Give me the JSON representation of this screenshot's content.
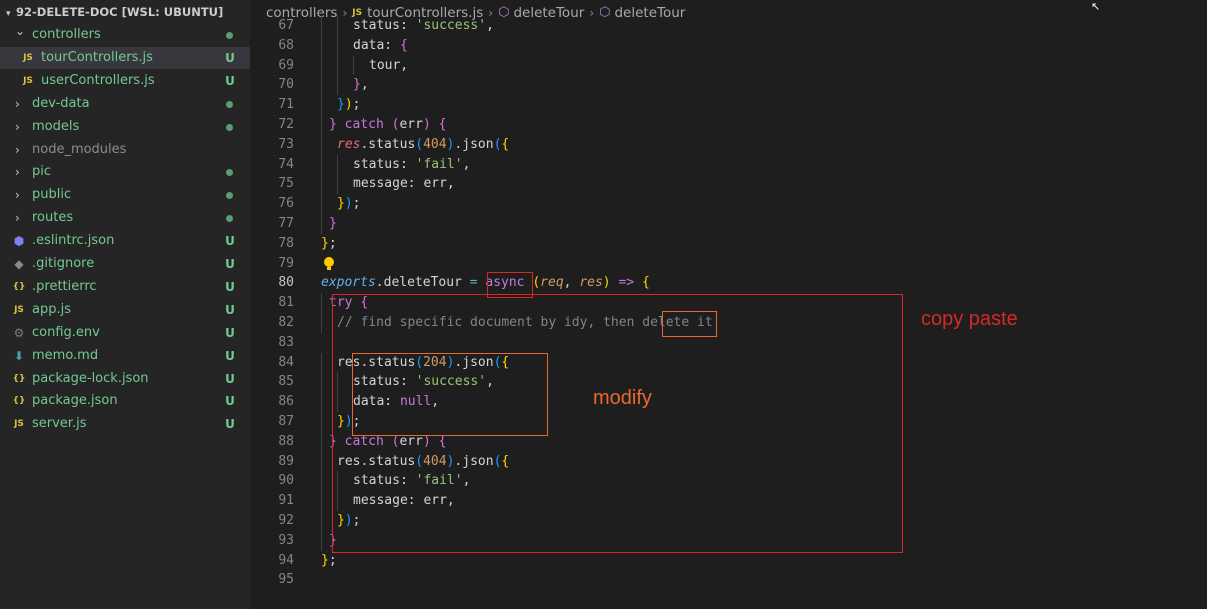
{
  "explorer": {
    "title": "92-DELETE-DOC [WSL: UBUNTU]",
    "items": [
      {
        "label": "controllers",
        "type": "folder-open",
        "depth": 0,
        "color": "#73c991",
        "badge": "dot"
      },
      {
        "label": "tourControllers.js",
        "type": "js",
        "depth": 1,
        "color": "#73c991",
        "badge": "U",
        "selected": true
      },
      {
        "label": "userControllers.js",
        "type": "js",
        "depth": 1,
        "color": "#73c991",
        "badge": "U"
      },
      {
        "label": "dev-data",
        "type": "folder",
        "depth": 0,
        "color": "#73c991",
        "badge": "dot"
      },
      {
        "label": "models",
        "type": "folder",
        "depth": 0,
        "color": "#73c991",
        "badge": "dot"
      },
      {
        "label": "node_modules",
        "type": "folder",
        "depth": 0,
        "color": "#8c8c8c",
        "badge": ""
      },
      {
        "label": "pic",
        "type": "folder",
        "depth": 0,
        "color": "#73c991",
        "badge": "dot"
      },
      {
        "label": "public",
        "type": "folder",
        "depth": 0,
        "color": "#73c991",
        "badge": "dot"
      },
      {
        "label": "routes",
        "type": "folder",
        "depth": 0,
        "color": "#73c991",
        "badge": "dot"
      },
      {
        "label": ".eslintrc.json",
        "type": "eslint",
        "depth": 0,
        "color": "#73c991",
        "badge": "U"
      },
      {
        "label": ".gitignore",
        "type": "git",
        "depth": 0,
        "color": "#73c991",
        "badge": "U"
      },
      {
        "label": ".prettierrc",
        "type": "json",
        "depth": 0,
        "color": "#73c991",
        "badge": "U"
      },
      {
        "label": "app.js",
        "type": "js",
        "depth": 0,
        "color": "#73c991",
        "badge": "U"
      },
      {
        "label": "config.env",
        "type": "gear",
        "depth": 0,
        "color": "#73c991",
        "badge": "U"
      },
      {
        "label": "memo.md",
        "type": "md",
        "depth": 0,
        "color": "#73c991",
        "badge": "U"
      },
      {
        "label": "package-lock.json",
        "type": "json",
        "depth": 0,
        "color": "#73c991",
        "badge": "U"
      },
      {
        "label": "package.json",
        "type": "json",
        "depth": 0,
        "color": "#73c991",
        "badge": "U"
      },
      {
        "label": "server.js",
        "type": "js",
        "depth": 0,
        "color": "#73c991",
        "badge": "U"
      }
    ]
  },
  "breadcrumb": {
    "folder": "controllers",
    "file_icon": "JS",
    "file": "tourControllers.js",
    "symbol1": "deleteTour",
    "symbol2": "deleteTour"
  },
  "code": {
    "active_line": 80,
    "lines": [
      {
        "n": "67",
        "indent": 2,
        "tokens": [
          [
            "",
            "status: "
          ],
          [
            "str",
            "'success'"
          ],
          [
            "",
            ","
          ]
        ]
      },
      {
        "n": "68",
        "indent": 2,
        "tokens": [
          [
            "",
            "data: "
          ],
          [
            "b2",
            "{"
          ]
        ]
      },
      {
        "n": "69",
        "indent": 3,
        "tokens": [
          [
            "",
            "tour,"
          ]
        ]
      },
      {
        "n": "70",
        "indent": 2,
        "tokens": [
          [
            "b2",
            "}"
          ],
          [
            "",
            ","
          ]
        ]
      },
      {
        "n": "71",
        "indent": 1,
        "tokens": [
          [
            "b3",
            "}"
          ],
          [
            "b1",
            ")"
          ],
          [
            "",
            ";"
          ]
        ]
      },
      {
        "n": "72",
        "indent": 0.5,
        "tokens": [
          [
            "b2",
            "}"
          ],
          [
            "",
            " "
          ],
          [
            "k",
            "catch"
          ],
          [
            "",
            " "
          ],
          [
            "b2",
            "("
          ],
          [
            "",
            "err"
          ],
          [
            "b2",
            ")"
          ],
          [
            "",
            " "
          ],
          [
            "b2",
            "{"
          ]
        ]
      },
      {
        "n": "73",
        "indent": 1,
        "tokens": [
          [
            "vi",
            "res"
          ],
          [
            "",
            ".status"
          ],
          [
            "b3",
            "("
          ],
          [
            "n",
            "404"
          ],
          [
            "b3",
            ")"
          ],
          [
            "",
            ".json"
          ],
          [
            "b3",
            "("
          ],
          [
            "b1",
            "{"
          ]
        ]
      },
      {
        "n": "74",
        "indent": 2,
        "tokens": [
          [
            "",
            "status: "
          ],
          [
            "str",
            "'fail'"
          ],
          [
            "",
            ","
          ]
        ]
      },
      {
        "n": "75",
        "indent": 2,
        "tokens": [
          [
            "",
            "message: err,"
          ]
        ]
      },
      {
        "n": "76",
        "indent": 1,
        "tokens": [
          [
            "b1",
            "}"
          ],
          [
            "b3",
            ")"
          ],
          [
            "",
            ";"
          ]
        ]
      },
      {
        "n": "77",
        "indent": 0.5,
        "tokens": [
          [
            "b2",
            "}"
          ]
        ]
      },
      {
        "n": "78",
        "indent": 0,
        "tokens": [
          [
            "b1",
            "}"
          ],
          [
            "",
            ";"
          ]
        ]
      },
      {
        "n": "79",
        "indent": 0,
        "tokens": [],
        "bulb": true
      },
      {
        "n": "80",
        "indent": 0,
        "tokens": [
          [
            "ex",
            "exports"
          ],
          [
            "",
            ".deleteTour "
          ],
          [
            "op",
            "="
          ],
          [
            "",
            " "
          ],
          [
            "k",
            "async"
          ],
          [
            "",
            " "
          ],
          [
            "b1",
            "("
          ],
          [
            "pm",
            "req"
          ],
          [
            "",
            ", "
          ],
          [
            "pm",
            "res"
          ],
          [
            "b1",
            ")"
          ],
          [
            "",
            " "
          ],
          [
            "k",
            "=>"
          ],
          [
            "",
            " "
          ],
          [
            "b1",
            "{"
          ]
        ]
      },
      {
        "n": "81",
        "indent": 0.5,
        "tokens": [
          [
            "k",
            "try"
          ],
          [
            "",
            " "
          ],
          [
            "b2",
            "{"
          ]
        ]
      },
      {
        "n": "82",
        "indent": 1,
        "tokens": [
          [
            "c",
            "// find specific document by idy, then delete it"
          ]
        ]
      },
      {
        "n": "83",
        "indent": 0,
        "tokens": []
      },
      {
        "n": "84",
        "indent": 1,
        "tokens": [
          [
            "",
            "res.status"
          ],
          [
            "b3",
            "("
          ],
          [
            "n",
            "204"
          ],
          [
            "b3",
            ")"
          ],
          [
            "",
            ".json"
          ],
          [
            "b3",
            "("
          ],
          [
            "b1",
            "{"
          ]
        ]
      },
      {
        "n": "85",
        "indent": 2,
        "tokens": [
          [
            "",
            "status: "
          ],
          [
            "str",
            "'success'"
          ],
          [
            "",
            ","
          ]
        ]
      },
      {
        "n": "86",
        "indent": 2,
        "tokens": [
          [
            "",
            "data: "
          ],
          [
            "k",
            "null"
          ],
          [
            "",
            ","
          ]
        ]
      },
      {
        "n": "87",
        "indent": 1,
        "tokens": [
          [
            "b1",
            "}"
          ],
          [
            "b3",
            ")"
          ],
          [
            "",
            ";"
          ]
        ]
      },
      {
        "n": "88",
        "indent": 0.5,
        "tokens": [
          [
            "b2",
            "}"
          ],
          [
            "",
            " "
          ],
          [
            "k",
            "catch"
          ],
          [
            "",
            " "
          ],
          [
            "b2",
            "("
          ],
          [
            "",
            "err"
          ],
          [
            "b2",
            ")"
          ],
          [
            "",
            " "
          ],
          [
            "b2",
            "{"
          ]
        ]
      },
      {
        "n": "89",
        "indent": 1,
        "tokens": [
          [
            "",
            "res.status"
          ],
          [
            "b3",
            "("
          ],
          [
            "n",
            "404"
          ],
          [
            "b3",
            ")"
          ],
          [
            "",
            ".json"
          ],
          [
            "b3",
            "("
          ],
          [
            "b1",
            "{"
          ]
        ]
      },
      {
        "n": "90",
        "indent": 2,
        "tokens": [
          [
            "",
            "status: "
          ],
          [
            "str",
            "'fail'"
          ],
          [
            "",
            ","
          ]
        ]
      },
      {
        "n": "91",
        "indent": 2,
        "tokens": [
          [
            "",
            "message: err,"
          ]
        ]
      },
      {
        "n": "92",
        "indent": 1,
        "tokens": [
          [
            "b1",
            "}"
          ],
          [
            "b3",
            ")"
          ],
          [
            "",
            ";"
          ]
        ]
      },
      {
        "n": "93",
        "indent": 0.5,
        "tokens": [
          [
            "b2",
            "}"
          ]
        ]
      },
      {
        "n": "94",
        "indent": 0,
        "tokens": [
          [
            "b1",
            "}"
          ],
          [
            "",
            ";"
          ]
        ]
      },
      {
        "n": "95",
        "indent": 0,
        "tokens": []
      }
    ]
  },
  "annotations": {
    "copy_paste": "copy paste",
    "modify": "modify",
    "box_red": "#d62828",
    "box_orange": "#e8692f"
  }
}
